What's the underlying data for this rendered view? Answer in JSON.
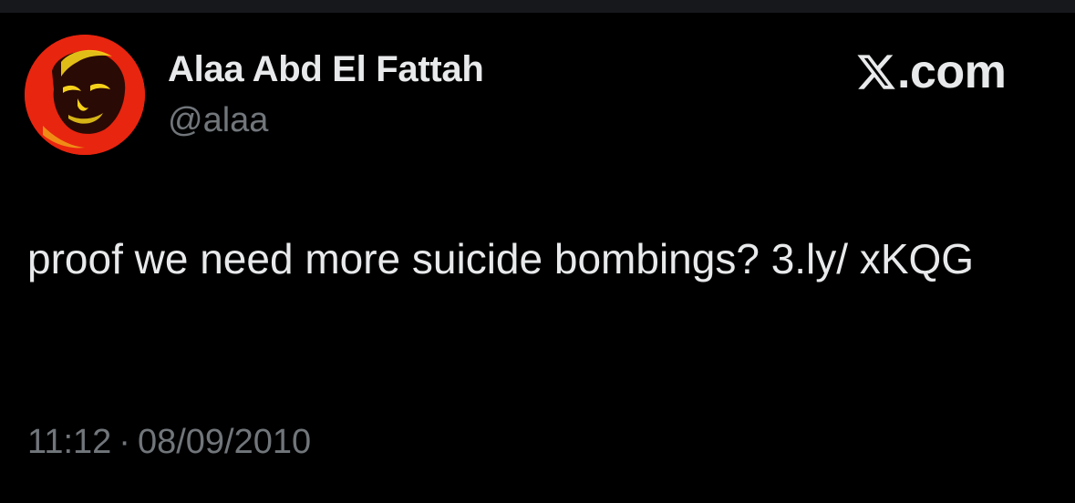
{
  "tweet": {
    "author": {
      "display_name": "Alaa Abd El Fattah",
      "handle": "@alaa",
      "avatar_icon": "profile-photo-red-tinted"
    },
    "brand": {
      "text": ".com",
      "icon": "x-logo-icon"
    },
    "text": "proof we need more suicide bombings? 3.ly/ xKQG",
    "time": "11:12",
    "separator": "·",
    "date": "08/09/2010"
  },
  "colors": {
    "background": "#000000",
    "primary_text": "#e7e9ea",
    "secondary_text": "#71767b",
    "avatar_red": "#e8250f",
    "avatar_yellow": "#f5d21a"
  }
}
